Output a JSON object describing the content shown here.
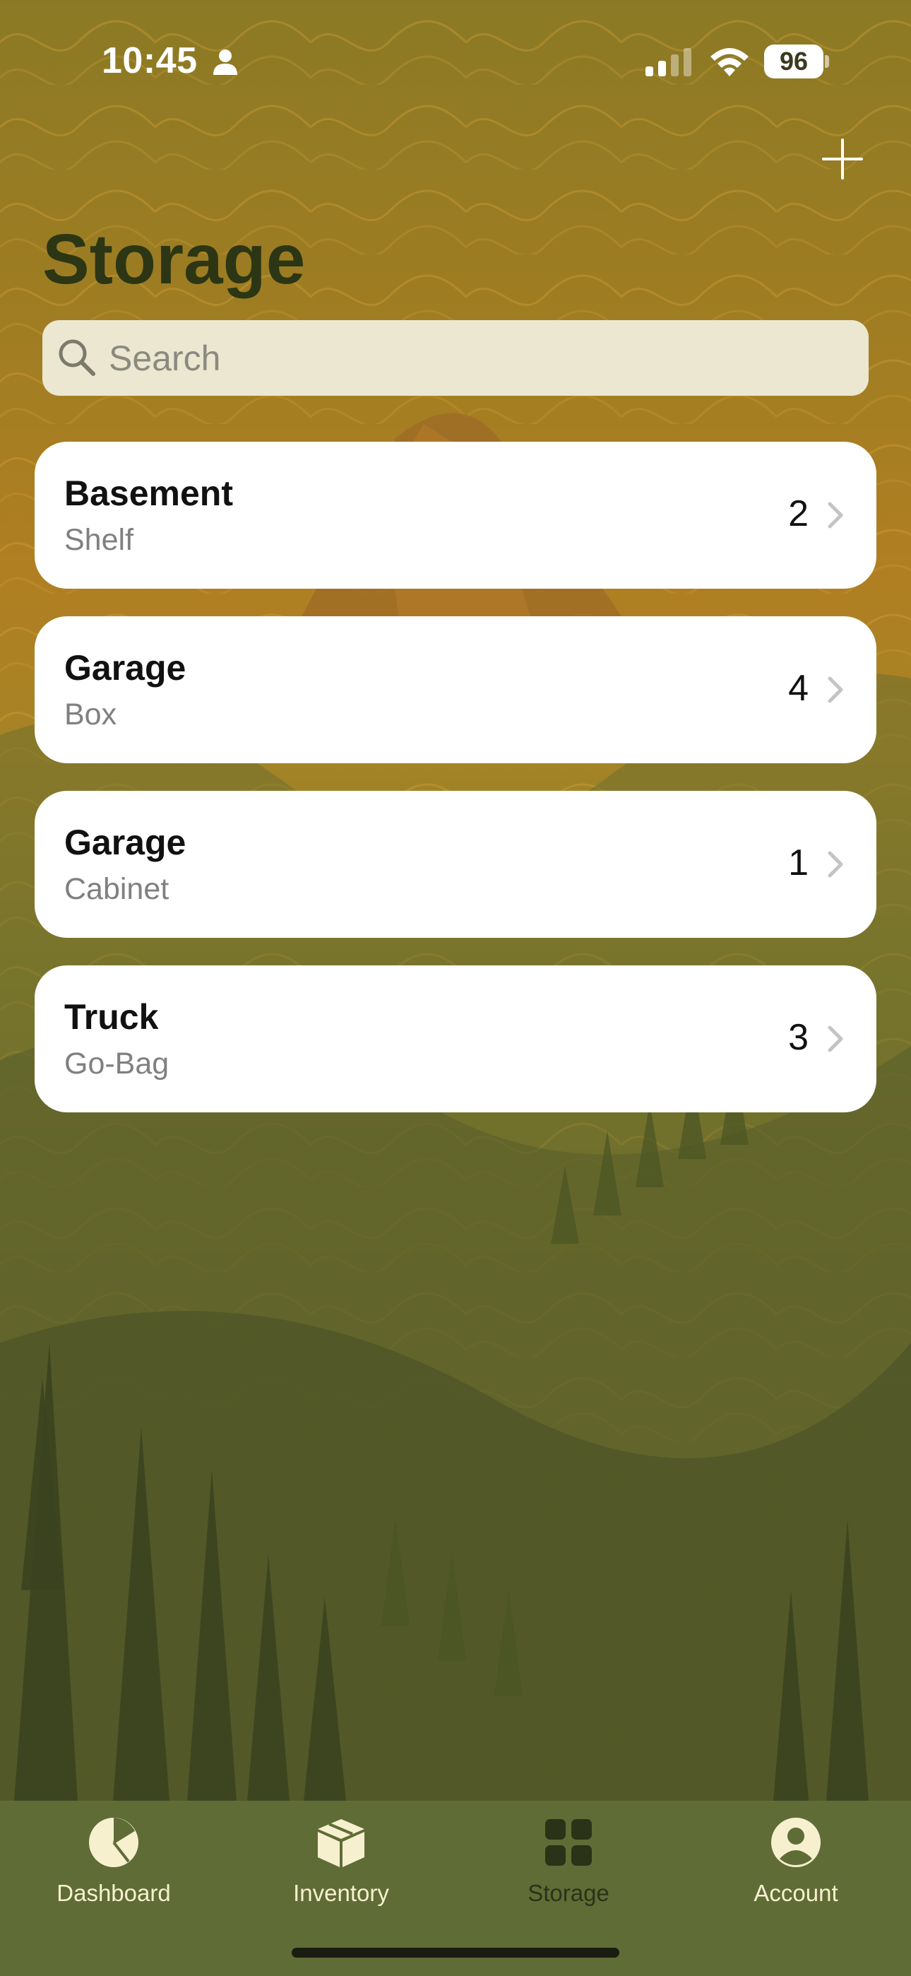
{
  "status_bar": {
    "time": "10:45",
    "battery_level": "96",
    "signal_bars_active": 2,
    "signal_bars_total": 4
  },
  "header": {
    "title": "Storage",
    "add_icon": "plus-icon"
  },
  "search": {
    "placeholder": "Search",
    "value": "",
    "icon": "search-icon"
  },
  "storage_locations": [
    {
      "name": "Basement",
      "type": "Shelf",
      "count": "2"
    },
    {
      "name": "Garage",
      "type": "Box",
      "count": "4"
    },
    {
      "name": "Garage",
      "type": "Cabinet",
      "count": "1"
    },
    {
      "name": "Truck",
      "type": "Go-Bag",
      "count": "3"
    }
  ],
  "tab_bar": {
    "tabs": [
      {
        "label": "Dashboard",
        "icon": "pie-chart-icon",
        "active": false
      },
      {
        "label": "Inventory",
        "icon": "box-icon",
        "active": false
      },
      {
        "label": "Storage",
        "icon": "grid-icon",
        "active": true
      },
      {
        "label": "Account",
        "icon": "person-circle-icon",
        "active": false
      }
    ]
  },
  "colors": {
    "title": "#2c3614",
    "search_background": "#ebe7d0",
    "card_background": "#ffffff",
    "tab_bar_background": "#5f6c36",
    "tab_inactive": "#f7f0cf",
    "tab_active": "#2a3318"
  }
}
